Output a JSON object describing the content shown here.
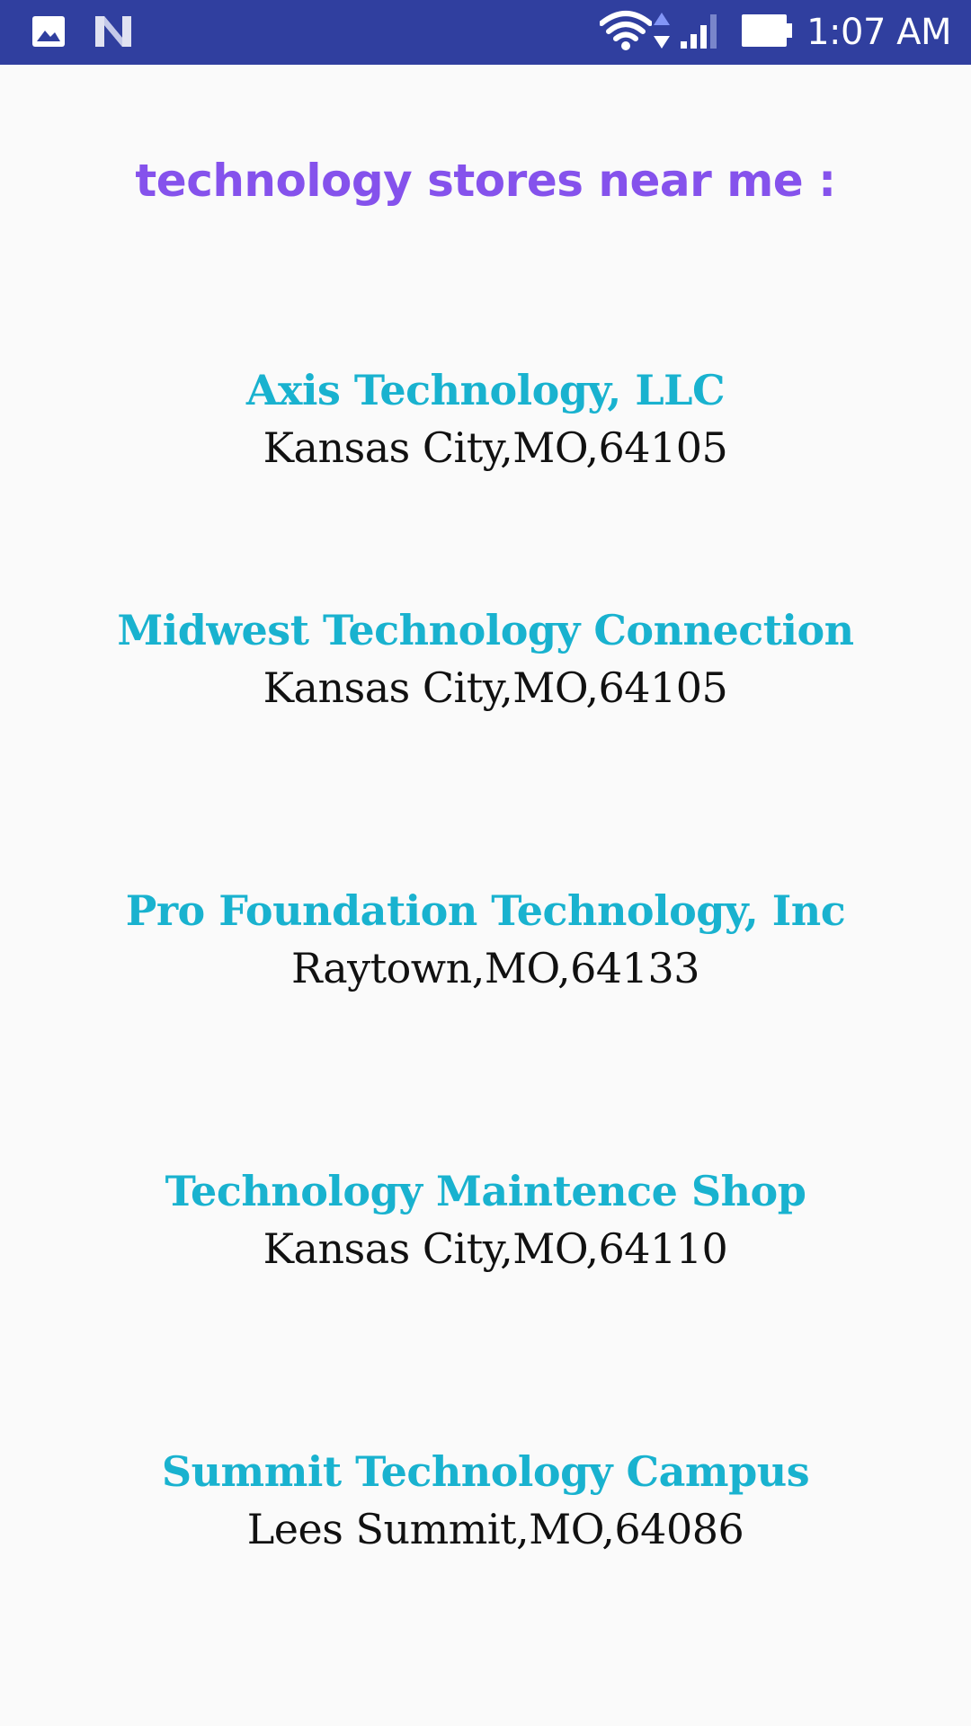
{
  "status_bar": {
    "time": "1:07 AM",
    "background": "#303f9f",
    "icons": [
      "image-icon",
      "n-app-icon",
      "wifi-icon",
      "data-arrows-icon",
      "signal-icon",
      "battery-icon"
    ]
  },
  "screen": {
    "title": "technology stores near me :",
    "title_color": "#8552ec"
  },
  "stores": [
    {
      "name": "Axis Technology, LLC",
      "address": "Kansas City,MO,64105"
    },
    {
      "name": "Midwest Technology Connection",
      "address": "Kansas City,MO,64105"
    },
    {
      "name": "Pro Foundation Technology, Inc",
      "address": "Raytown,MO,64133"
    },
    {
      "name": "Technology Maintence Shop",
      "address": "Kansas City,MO,64110"
    },
    {
      "name": "Summit Technology Campus",
      "address": "Lees Summit,MO,64086"
    }
  ],
  "colors": {
    "store_name": "#19b2cf",
    "store_address": "#111111",
    "background": "#fafafa"
  }
}
